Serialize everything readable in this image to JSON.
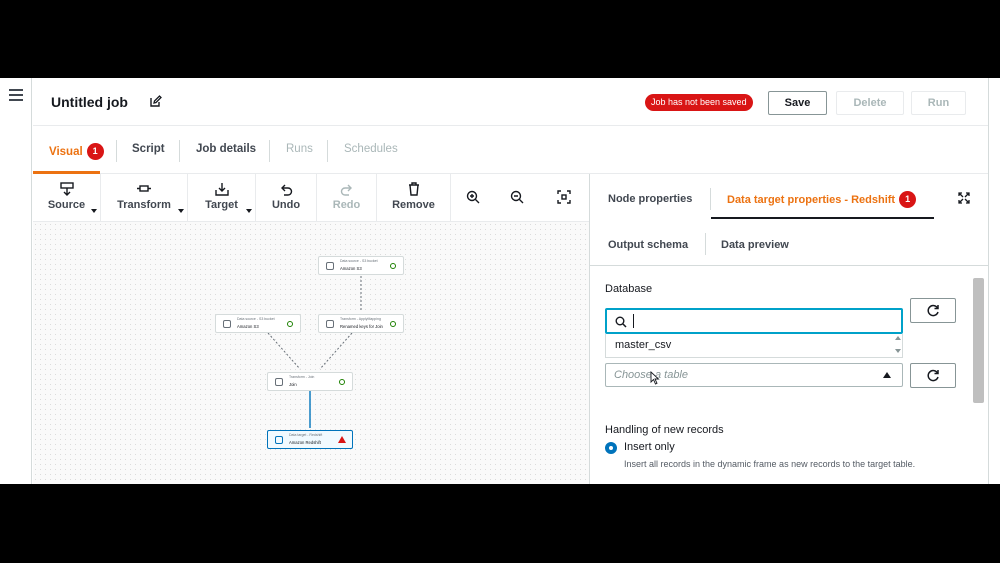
{
  "header": {
    "title": "Untitled job",
    "unsaved_badge": "Job has not been saved",
    "save_label": "Save",
    "delete_label": "Delete",
    "run_label": "Run"
  },
  "tabs": [
    {
      "label": "Visual",
      "count": "1"
    },
    {
      "label": "Script"
    },
    {
      "label": "Job details"
    },
    {
      "label": "Runs"
    },
    {
      "label": "Schedules"
    }
  ],
  "toolbar": {
    "source": "Source",
    "transform": "Transform",
    "target": "Target",
    "undo": "Undo",
    "redo": "Redo",
    "remove": "Remove"
  },
  "canvas": {
    "nodes": [
      {
        "kind": "Data source - S3 bucket",
        "name": "Amazon S3"
      },
      {
        "kind": "Data source - S3 bucket",
        "name": "Amazon S3"
      },
      {
        "kind": "Transform - ApplyMapping",
        "name": "Renamed keys for Join"
      },
      {
        "kind": "Transform - Join",
        "name": "Join"
      },
      {
        "kind": "Data target - Redshift",
        "name": "Amazon Redshift"
      }
    ]
  },
  "panel": {
    "tab_node_properties": "Node properties",
    "tab_data_target": "Data target properties - Redshift",
    "tab_data_target_count": "1",
    "tab_output_schema": "Output schema",
    "tab_data_preview": "Data preview",
    "database_label": "Database",
    "search_value": "",
    "dropdown_option": "master_csv",
    "table_placeholder": "Choose a table",
    "handling_label": "Handling of new records",
    "radio_label": "Insert only",
    "radio_desc": "Insert all records in the dynamic frame as new records to the target table."
  },
  "colors": {
    "accent": "#ec7211",
    "danger": "#d91515",
    "focus": "#00a1c9",
    "primary": "#0073bb"
  }
}
